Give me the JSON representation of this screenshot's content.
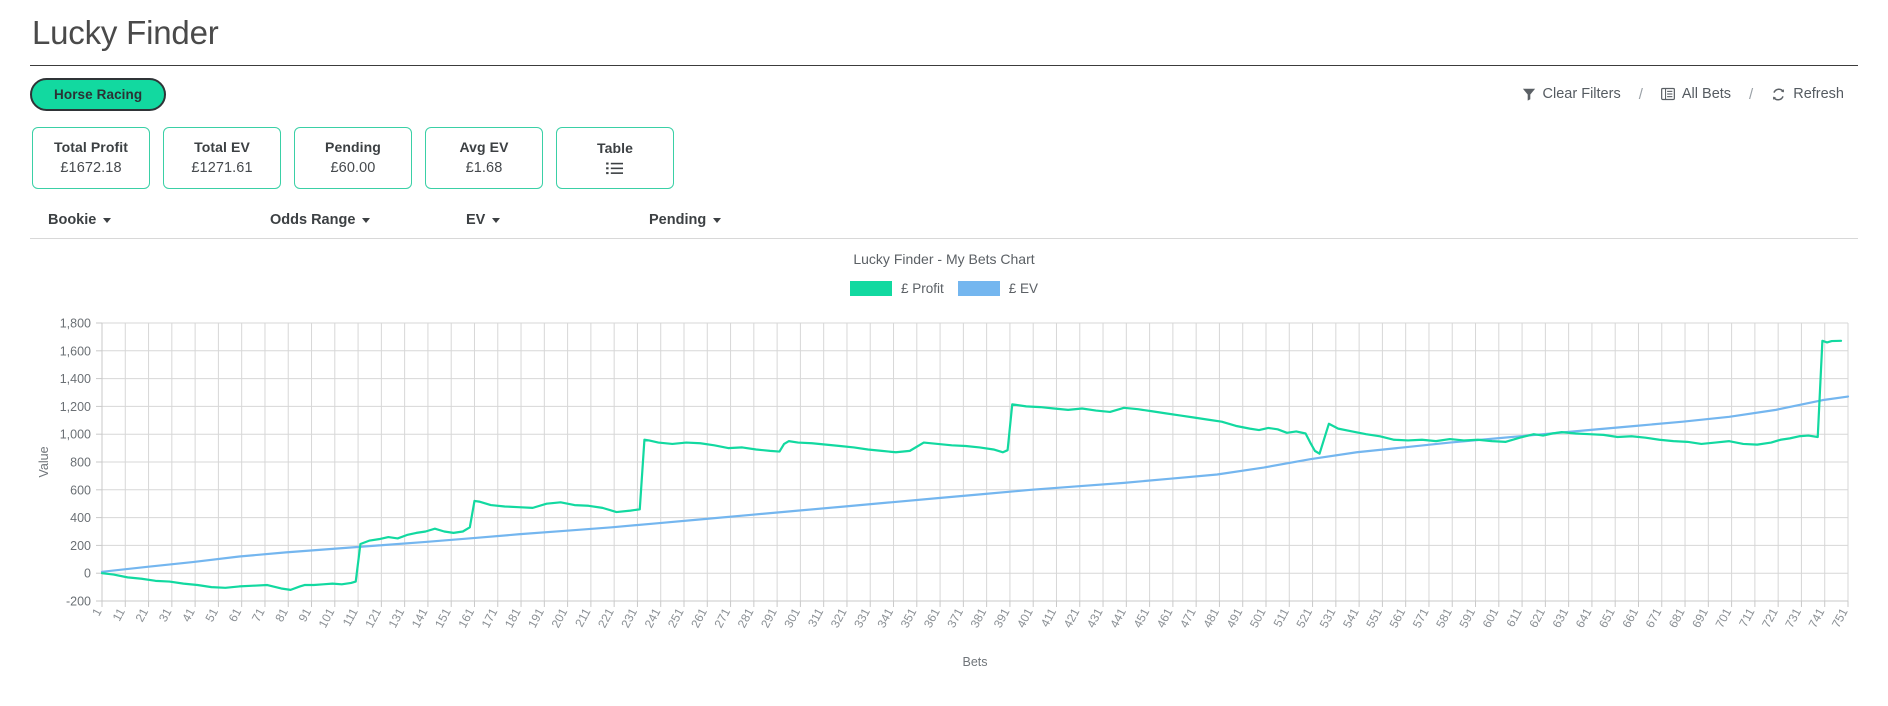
{
  "header": {
    "title": "Lucky Finder"
  },
  "toolbar": {
    "sport_pill": "Horse Racing",
    "actions": [
      {
        "label": "Clear Filters",
        "icon": "filter-icon"
      },
      {
        "label": "All Bets",
        "icon": "list-view-icon"
      },
      {
        "label": "Refresh",
        "icon": "refresh-icon"
      }
    ],
    "separator": "/"
  },
  "cards": [
    {
      "label": "Total Profit",
      "value": "£1672.18"
    },
    {
      "label": "Total EV",
      "value": "£1271.61"
    },
    {
      "label": "Pending",
      "value": "£60.00"
    },
    {
      "label": "Avg EV",
      "value": "£1.68"
    },
    {
      "label": "Table",
      "value": "",
      "icon": "list-icon"
    }
  ],
  "filters": [
    {
      "label": "Bookie"
    },
    {
      "label": "Odds Range"
    },
    {
      "label": "EV"
    },
    {
      "label": "Pending"
    }
  ],
  "colors": {
    "profit": "#12d9a0",
    "ev": "#74b6ef",
    "card_border": "#3ad0a6",
    "pill_bg": "#12d9a0",
    "pill_border": "#2f3437",
    "grid": "#d7d7d7"
  },
  "chart_data": {
    "type": "line",
    "title": "Lucky Finder - My Bets Chart",
    "xlabel": "Bets",
    "ylabel": "Value",
    "ylim": [
      -200,
      1800
    ],
    "ytick_labels": [
      "1,800",
      "1,600",
      "1,400",
      "1,200",
      "1,000",
      "800",
      "600",
      "400",
      "200",
      "0",
      "-200"
    ],
    "ytick_values": [
      1800,
      1600,
      1400,
      1200,
      1000,
      800,
      600,
      400,
      200,
      0,
      -200
    ],
    "xlim": [
      1,
      751
    ],
    "xtick_step": 10,
    "xtick_labels": [
      "1",
      "11",
      "21",
      "31",
      "41",
      "51",
      "61",
      "71",
      "81",
      "91",
      "101",
      "111",
      "121",
      "131",
      "141",
      "151",
      "161",
      "171",
      "181",
      "191",
      "201",
      "211",
      "221",
      "231",
      "241",
      "251",
      "261",
      "271",
      "281",
      "291",
      "301",
      "311",
      "321",
      "331",
      "341",
      "351",
      "361",
      "371",
      "381",
      "391",
      "401",
      "411",
      "421",
      "431",
      "441",
      "451",
      "461",
      "471",
      "481",
      "491",
      "501",
      "511",
      "521",
      "531",
      "541",
      "551",
      "561",
      "571",
      "581",
      "591",
      "601",
      "611",
      "621",
      "631",
      "641",
      "651",
      "661",
      "671",
      "681",
      "691",
      "701",
      "711",
      "721",
      "731",
      "741",
      "751"
    ],
    "grid": true,
    "legend_position": "top",
    "series": [
      {
        "name": "£ Profit",
        "color": "#12d9a0",
        "x": [
          1,
          6,
          12,
          18,
          24,
          30,
          36,
          42,
          48,
          54,
          60,
          66,
          72,
          78,
          82,
          86,
          88,
          92,
          96,
          100,
          104,
          108,
          110,
          112,
          116,
          120,
          124,
          128,
          132,
          136,
          140,
          144,
          148,
          152,
          156,
          159,
          161,
          163,
          168,
          174,
          180,
          186,
          192,
          198,
          204,
          210,
          216,
          222,
          228,
          232,
          234,
          236,
          240,
          246,
          252,
          258,
          264,
          270,
          276,
          282,
          288,
          292,
          294,
          296,
          300,
          306,
          312,
          318,
          324,
          330,
          336,
          342,
          348,
          354,
          360,
          366,
          372,
          378,
          384,
          388,
          390,
          392,
          398,
          404,
          410,
          416,
          422,
          428,
          434,
          440,
          446,
          452,
          458,
          464,
          470,
          476,
          482,
          488,
          494,
          498,
          502,
          506,
          510,
          514,
          518,
          520,
          522,
          524,
          528,
          532,
          538,
          544,
          550,
          556,
          562,
          568,
          574,
          580,
          586,
          592,
          598,
          604,
          610,
          616,
          620,
          624,
          628,
          634,
          640,
          646,
          652,
          658,
          664,
          670,
          676,
          682,
          688,
          694,
          700,
          706,
          712,
          718,
          722,
          726,
          730,
          734,
          738,
          740,
          742,
          744,
          748,
          751
        ],
        "y": [
          0,
          -10,
          -30,
          -40,
          -55,
          -60,
          -75,
          -85,
          -100,
          -105,
          -95,
          -90,
          -85,
          -110,
          -120,
          -95,
          -85,
          -85,
          -80,
          -75,
          -80,
          -70,
          -60,
          210,
          235,
          245,
          260,
          250,
          275,
          290,
          300,
          320,
          300,
          290,
          300,
          330,
          520,
          515,
          490,
          480,
          475,
          470,
          500,
          510,
          490,
          485,
          470,
          440,
          450,
          460,
          960,
          955,
          940,
          930,
          940,
          935,
          920,
          900,
          905,
          890,
          880,
          875,
          930,
          950,
          940,
          935,
          925,
          915,
          905,
          890,
          880,
          870,
          880,
          940,
          930,
          920,
          915,
          905,
          890,
          870,
          885,
          1215,
          1200,
          1195,
          1185,
          1175,
          1185,
          1170,
          1160,
          1190,
          1180,
          1165,
          1150,
          1135,
          1120,
          1105,
          1090,
          1060,
          1040,
          1030,
          1045,
          1035,
          1010,
          1020,
          1005,
          940,
          880,
          860,
          1075,
          1040,
          1020,
          1000,
          985,
          960,
          955,
          960,
          950,
          965,
          955,
          960,
          950,
          945,
          975,
          1000,
          990,
          1005,
          1015,
          1005,
          1000,
          995,
          980,
          985,
          975,
          960,
          950,
          945,
          930,
          940,
          950,
          930,
          925,
          940,
          960,
          970,
          985,
          990,
          980,
          1672,
          1660,
          1670,
          1672
        ]
      },
      {
        "name": "£ EV",
        "color": "#74b6ef",
        "x": [
          1,
          20,
          40,
          60,
          80,
          100,
          120,
          140,
          160,
          180,
          200,
          220,
          240,
          260,
          280,
          300,
          320,
          340,
          360,
          380,
          400,
          420,
          440,
          460,
          480,
          500,
          520,
          540,
          560,
          580,
          600,
          620,
          640,
          660,
          680,
          700,
          720,
          740,
          751
        ],
        "y": [
          10,
          45,
          80,
          120,
          150,
          175,
          200,
          225,
          252,
          280,
          305,
          330,
          360,
          390,
          420,
          450,
          480,
          510,
          540,
          570,
          600,
          625,
          650,
          680,
          710,
          760,
          820,
          870,
          905,
          940,
          970,
          1000,
          1030,
          1060,
          1090,
          1125,
          1175,
          1245,
          1271
        ]
      }
    ]
  }
}
